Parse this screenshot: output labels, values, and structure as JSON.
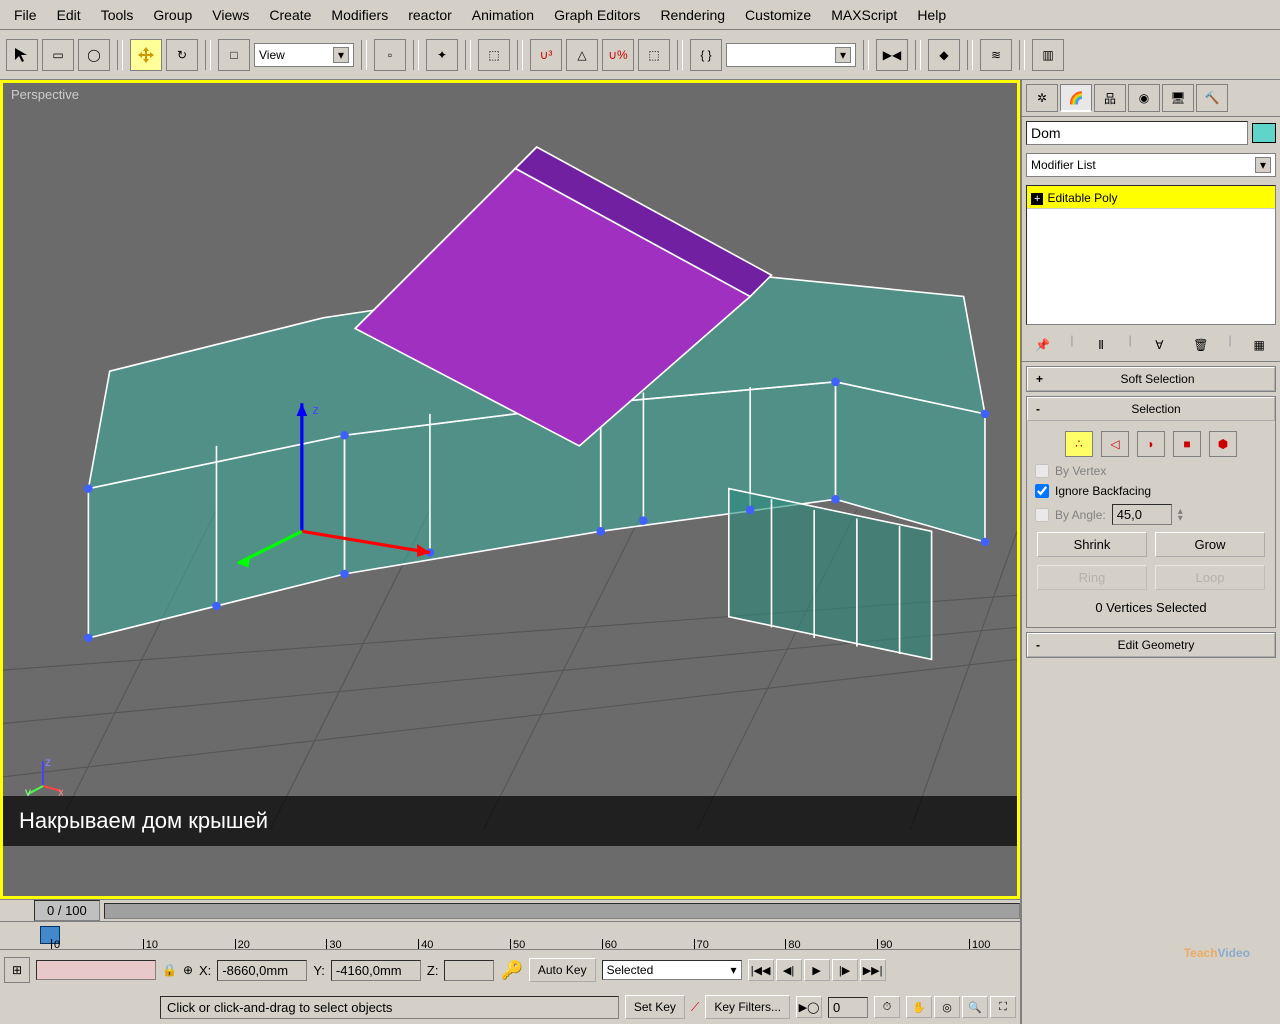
{
  "menu": {
    "items": [
      "File",
      "Edit",
      "Tools",
      "Group",
      "Views",
      "Create",
      "Modifiers",
      "reactor",
      "Animation",
      "Graph Editors",
      "Rendering",
      "Customize",
      "MAXScript",
      "Help"
    ]
  },
  "toolbar": {
    "view_dd": "View"
  },
  "viewport": {
    "label": "Perspective"
  },
  "subtitle": "Накрываем дом крышей",
  "panel": {
    "object_name": "Dom",
    "modlist_label": "Modifier List",
    "mod_item": "Editable Poly",
    "rollouts": {
      "soft_selection": {
        "sign": "+",
        "title": "Soft Selection"
      },
      "selection": {
        "sign": "-",
        "title": "Selection",
        "by_vertex": "By Vertex",
        "ignore_backfacing": "Ignore Backfacing",
        "by_angle": "By Angle:",
        "angle_value": "45,0",
        "shrink": "Shrink",
        "grow": "Grow",
        "ring": "Ring",
        "loop": "Loop",
        "status": "0 Vertices Selected"
      },
      "edit_geometry": {
        "sign": "-",
        "title": "Edit Geometry"
      }
    }
  },
  "timeline": {
    "frame_display": "0 / 100",
    "ticks": [
      "0",
      "10",
      "20",
      "30",
      "40",
      "50",
      "60",
      "70",
      "80",
      "90",
      "100"
    ]
  },
  "bottom": {
    "x_label": "X:",
    "x_val": "-8660,0mm",
    "y_label": "Y:",
    "y_val": "-4160,0mm",
    "z_label": "Z:",
    "z_val": "",
    "auto_key": "Auto Key",
    "set_key": "Set Key",
    "selected": "Selected",
    "key_filters": "Key Filters...",
    "status_text": "Click or click-and-drag to select objects"
  },
  "watermark": {
    "t": "Teach",
    "v": "Video"
  }
}
